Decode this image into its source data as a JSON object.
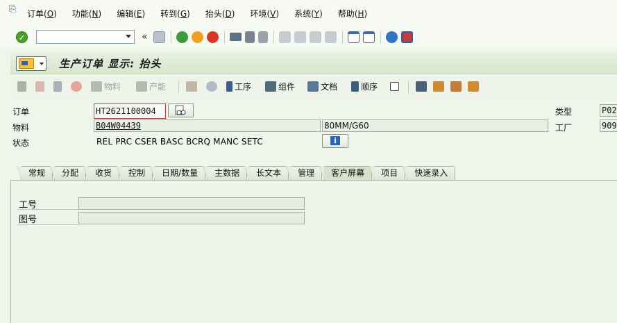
{
  "menu": {
    "items": [
      {
        "label": "订单(",
        "key": "O",
        "end": ")"
      },
      {
        "label": "功能(",
        "key": "N",
        "end": ")"
      },
      {
        "label": "编辑(",
        "key": "E",
        "end": ")"
      },
      {
        "label": "转到(",
        "key": "G",
        "end": ")"
      },
      {
        "label": "抬头(",
        "key": "D",
        "end": ")"
      },
      {
        "label": "环境(",
        "key": "V",
        "end": ")"
      },
      {
        "label": "系统(",
        "key": "Y",
        "end": ")"
      },
      {
        "label": "帮助(",
        "key": "H",
        "end": ")"
      }
    ]
  },
  "standard_toolbar": {
    "command_value": "",
    "back_symbol": "«"
  },
  "title": "生产订单 显示: 抬头",
  "app_toolbar": {
    "material_label": "物料",
    "capacity_label": "产能",
    "operations_label": "工序",
    "components_label": "组件",
    "documents_label": "文档",
    "sequences_label": "顺序"
  },
  "header": {
    "order_label": "订单",
    "order_value": "HT2621100004",
    "type_label": "类型",
    "type_value": "P02",
    "material_label": "物料",
    "material_value": "B04W04439",
    "material_desc": "80MM/G60",
    "plant_label": "工厂",
    "plant_value": "909",
    "status_label": "状态",
    "status_value": "REL  PRC  CSER BASC BCRQ MANC SETC",
    "info_icon_glyph": "i"
  },
  "tabs": [
    {
      "label": "常规",
      "active": false
    },
    {
      "label": "分配",
      "active": false
    },
    {
      "label": "收货",
      "active": false
    },
    {
      "label": "控制",
      "active": false
    },
    {
      "label": "日期/数量",
      "active": false
    },
    {
      "label": "主数据",
      "active": false
    },
    {
      "label": "长文本",
      "active": false
    },
    {
      "label": "管理",
      "active": false
    },
    {
      "label": "客户屏幕",
      "active": true
    },
    {
      "label": "项目",
      "active": false
    },
    {
      "label": "快速录入",
      "active": false
    }
  ],
  "customer_screen": {
    "job_no_label": "工号",
    "job_no_value": "",
    "drawing_no_label": "图号",
    "drawing_no_value": ""
  }
}
